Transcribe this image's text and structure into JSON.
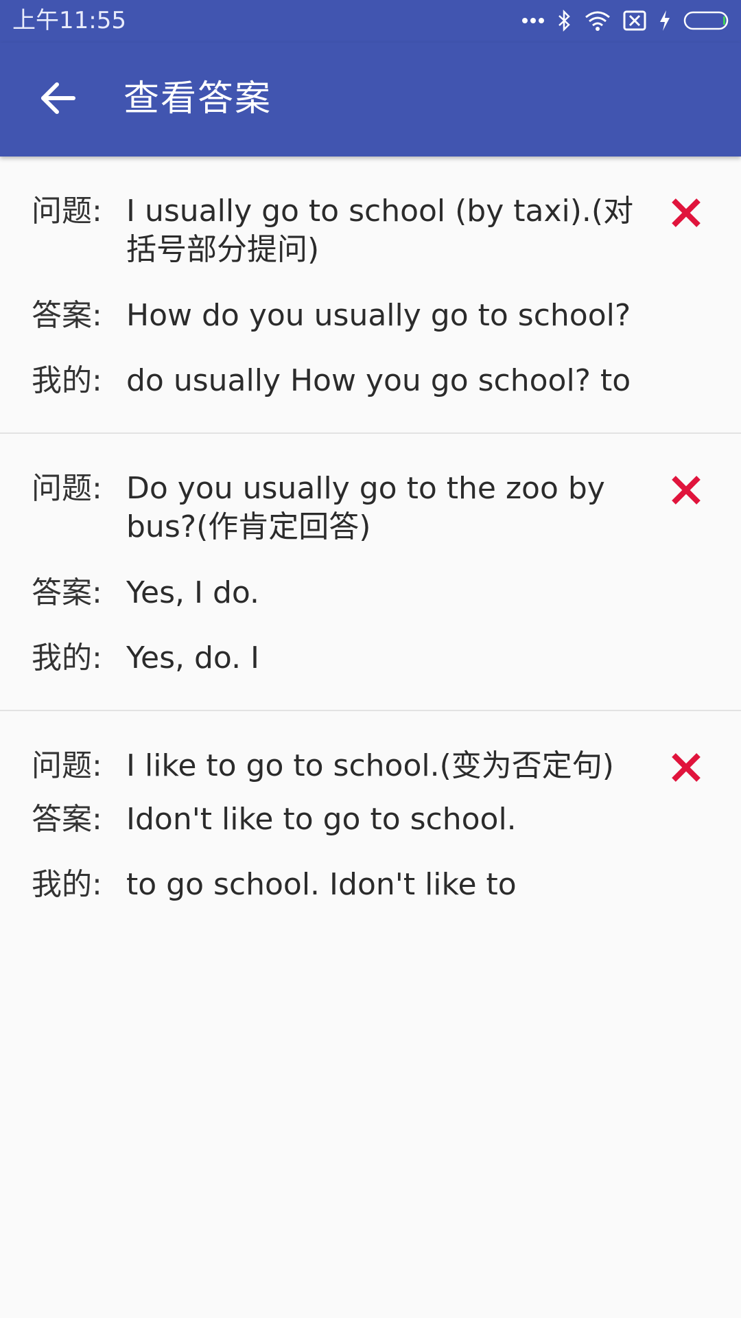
{
  "status_bar": {
    "time": "上午11:55"
  },
  "app_bar": {
    "title": "查看答案"
  },
  "labels": {
    "question": "问题:",
    "answer": "答案:",
    "mine": "我的:"
  },
  "items": [
    {
      "question": "I usually go to school (by taxi).(对括号部分提问)",
      "answer": "How do you usually go to school?",
      "mine": "do usually How you go school? to",
      "result_icon": "wrong-x-icon"
    },
    {
      "question": "Do you usually go to the zoo by bus?(作肯定回答)",
      "answer": "Yes, I do.",
      "mine": "Yes, do. I",
      "result_icon": "wrong-x-icon"
    },
    {
      "question": "I like to go to school.(变为否定句)",
      "answer": "Idon't like to go to school.",
      "mine": "to go school. Idon't like to",
      "result_icon": "wrong-x-icon"
    }
  ],
  "colors": {
    "primary": "#4155b0",
    "wrong": "#e0143c",
    "background": "#fafafa"
  }
}
